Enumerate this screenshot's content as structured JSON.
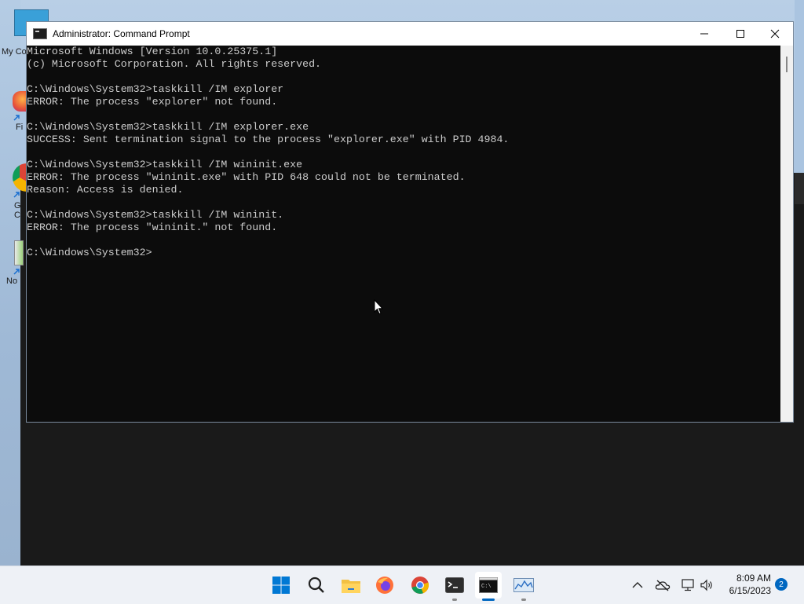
{
  "desktop": {
    "icons": [
      {
        "label": "My Co"
      },
      {
        "label": "Fi"
      },
      {
        "label": "G\nC"
      },
      {
        "label": "No"
      }
    ]
  },
  "window": {
    "title": "Administrator: Command Prompt",
    "buttons": {
      "minimize": "minimize-icon",
      "maximize": "maximize-icon",
      "close": "close-icon"
    }
  },
  "console": {
    "lines": [
      "Microsoft Windows [Version 10.0.25375.1]",
      "(c) Microsoft Corporation. All rights reserved.",
      "",
      "C:\\Windows\\System32>taskkill /IM explorer",
      "ERROR: The process \"explorer\" not found.",
      "",
      "C:\\Windows\\System32>taskkill /IM explorer.exe",
      "SUCCESS: Sent termination signal to the process \"explorer.exe\" with PID 4984.",
      "",
      "C:\\Windows\\System32>taskkill /IM wininit.exe",
      "ERROR: The process \"wininit.exe\" with PID 648 could not be terminated.",
      "Reason: Access is denied.",
      "",
      "C:\\Windows\\System32>taskkill /IM wininit.",
      "ERROR: The process \"wininit.\" not found.",
      "",
      "C:\\Windows\\System32>"
    ]
  },
  "taskbar": {
    "apps": [
      "start-icon",
      "search-icon",
      "file-explorer-icon",
      "firefox-icon",
      "chrome-icon",
      "terminal-icon",
      "command-prompt-icon",
      "performance-monitor-icon"
    ],
    "tray": [
      "chevron-up-icon",
      "onedrive-offline-icon",
      "network-icon",
      "volume-icon"
    ],
    "time": "8:09 AM",
    "date": "6/15/2023",
    "notification_count": "2"
  },
  "colors": {
    "accent": "#0067c0",
    "console_bg": "#0c0c0c",
    "console_text": "#cccccc"
  }
}
